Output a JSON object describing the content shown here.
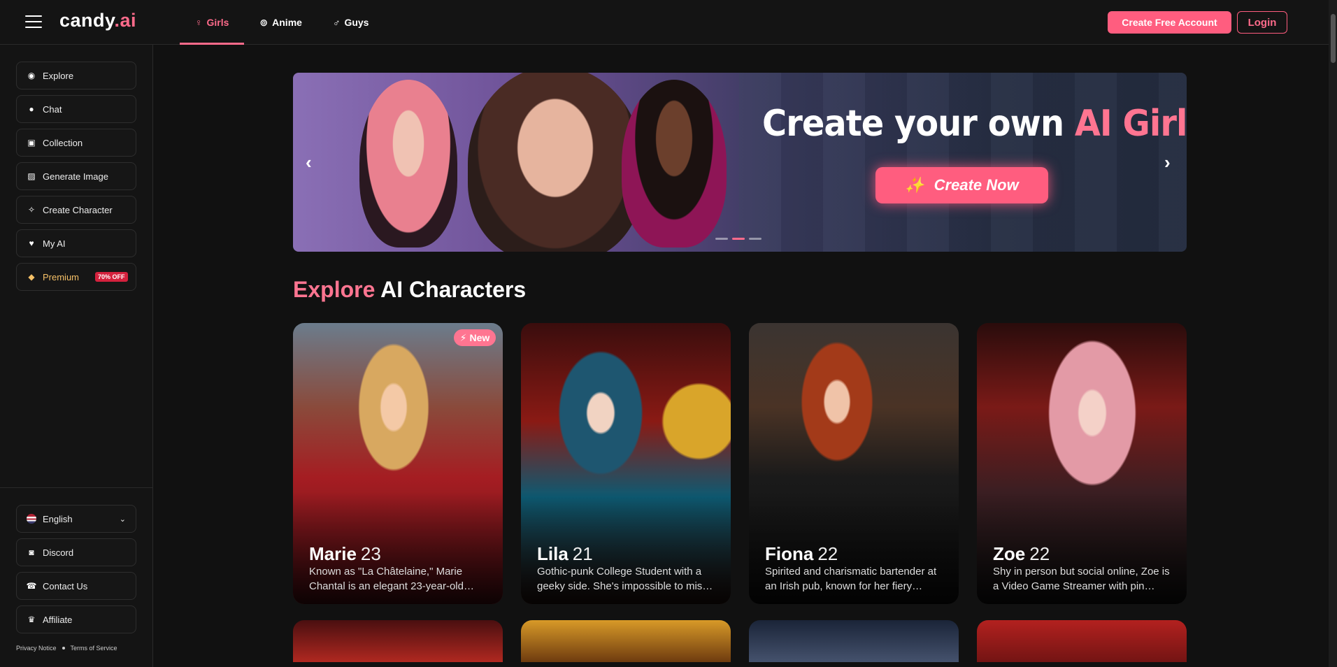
{
  "header": {
    "logo_main": "candy",
    "logo_accent": ".ai",
    "tabs": [
      {
        "label": "Girls",
        "icon": "female-symbol-icon"
      },
      {
        "label": "Anime",
        "icon": "anime-swirl-icon"
      },
      {
        "label": "Guys",
        "icon": "male-symbol-icon"
      }
    ],
    "create_account_label": "Create Free Account",
    "login_label": "Login"
  },
  "sidebar": {
    "items": [
      {
        "label": "Explore",
        "icon": "compass-icon"
      },
      {
        "label": "Chat",
        "icon": "chat-bubble-icon"
      },
      {
        "label": "Collection",
        "icon": "collection-icon"
      },
      {
        "label": "Generate Image",
        "icon": "image-icon"
      },
      {
        "label": "Create Character",
        "icon": "magic-wand-icon"
      },
      {
        "label": "My AI",
        "icon": "heart-icon"
      },
      {
        "label": "Premium",
        "icon": "diamond-icon",
        "badge": "70% OFF"
      }
    ],
    "language": "English",
    "bottom_items": [
      {
        "label": "Discord",
        "icon": "discord-icon"
      },
      {
        "label": "Contact Us",
        "icon": "phone-icon"
      },
      {
        "label": "Affiliate",
        "icon": "trophy-icon"
      }
    ],
    "privacy_label": "Privacy Notice",
    "terms_label": "Terms of Service"
  },
  "banner": {
    "title_white": "Create your own ",
    "title_pink": "AI Girlfriend",
    "cta_label": "Create Now"
  },
  "section": {
    "title_pink": "Explore",
    "title_white": " AI Characters"
  },
  "cards": [
    {
      "name": "Marie",
      "age": "23",
      "desc": "Known as \"La Châtelaine,\" Marie Chantal is an elegant 23-year-old…",
      "badge": "New"
    },
    {
      "name": "Lila",
      "age": "21",
      "desc": "Gothic-punk College Student with a geeky side. She's impossible to mis…"
    },
    {
      "name": "Fiona",
      "age": "22",
      "desc": "Spirited and charismatic bartender at an Irish pub, known for her fiery…"
    },
    {
      "name": "Zoe",
      "age": "22",
      "desc": "Shy in person but social online, Zoe is a Video Game Streamer with pin…"
    }
  ],
  "colors": {
    "accent": "#ff5d7f",
    "background": "#111111",
    "premium": "#f5c067"
  }
}
